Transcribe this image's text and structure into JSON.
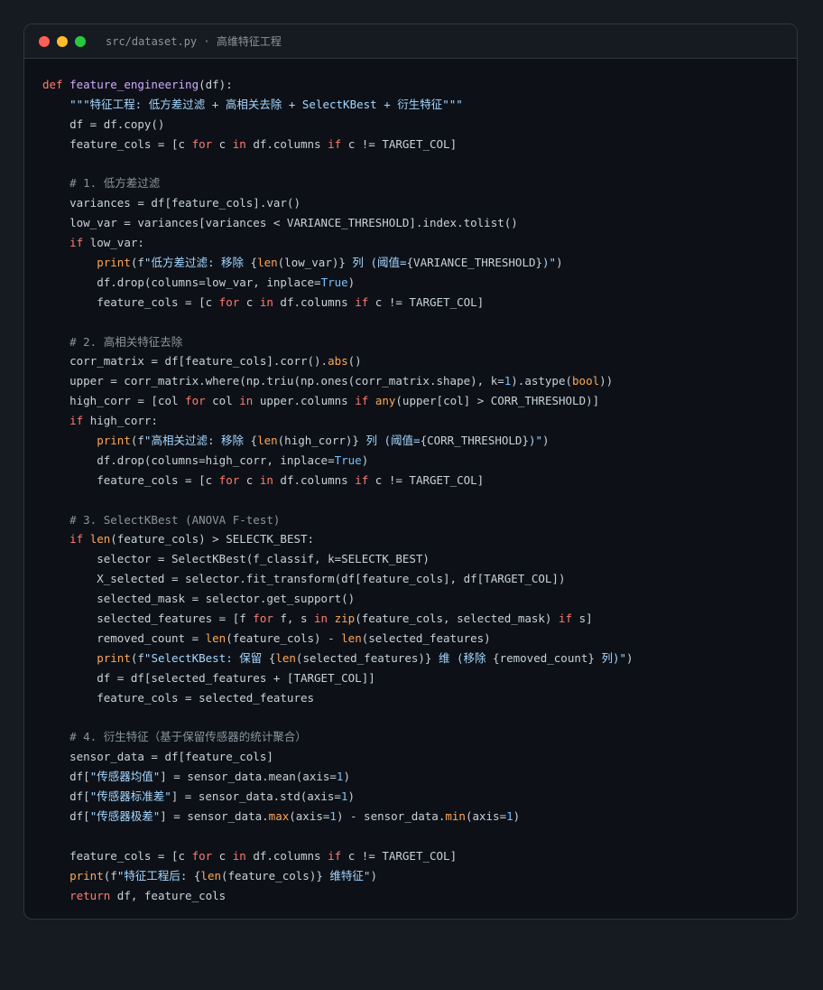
{
  "window": {
    "filename": "src/dataset.py · 高维特征工程",
    "dot_colors": [
      "#ff5f57",
      "#febc2e",
      "#28c840"
    ]
  },
  "code_lines": [
    [
      [
        "kw",
        "def "
      ],
      [
        "fn",
        "feature_engineering"
      ],
      [
        "pl",
        "(df):"
      ]
    ],
    [
      [
        "pl",
        "    "
      ],
      [
        "str",
        "\"\"\"特征工程: 低方差过滤 + 高相关去除 + SelectKBest + 衍生特征\"\"\""
      ]
    ],
    [
      [
        "pl",
        "    df = df.copy()"
      ]
    ],
    [
      [
        "pl",
        "    feature_cols = [c "
      ],
      [
        "kw",
        "for"
      ],
      [
        "pl",
        " c "
      ],
      [
        "kw",
        "in"
      ],
      [
        "pl",
        " df.columns "
      ],
      [
        "kw",
        "if"
      ],
      [
        "pl",
        " c != TARGET_COL]"
      ]
    ],
    [],
    [
      [
        "pl",
        "    "
      ],
      [
        "cm",
        "# 1. 低方差过滤"
      ]
    ],
    [
      [
        "pl",
        "    variances = df[feature_cols].var()"
      ]
    ],
    [
      [
        "pl",
        "    low_var = variances[variances < VARIANCE_THRESHOLD].index.tolist()"
      ]
    ],
    [
      [
        "pl",
        "    "
      ],
      [
        "kw",
        "if"
      ],
      [
        "pl",
        " low_var:"
      ]
    ],
    [
      [
        "pl",
        "        "
      ],
      [
        "bi",
        "print"
      ],
      [
        "pl",
        "(f"
      ],
      [
        "str",
        "\"低方差过滤: 移除 "
      ],
      [
        "pl",
        "{"
      ],
      [
        "bi",
        "len"
      ],
      [
        "pl",
        "(low_var)}"
      ],
      [
        "str",
        " 列 (阈值="
      ],
      [
        "pl",
        "{VARIANCE_THRESHOLD}"
      ],
      [
        "str",
        ")\""
      ],
      [
        "pl",
        ")"
      ]
    ],
    [
      [
        "pl",
        "        df.drop(columns=low_var, inplace="
      ],
      [
        "num",
        "True"
      ],
      [
        "pl",
        ")"
      ]
    ],
    [
      [
        "pl",
        "        feature_cols = [c "
      ],
      [
        "kw",
        "for"
      ],
      [
        "pl",
        " c "
      ],
      [
        "kw",
        "in"
      ],
      [
        "pl",
        " df.columns "
      ],
      [
        "kw",
        "if"
      ],
      [
        "pl",
        " c != TARGET_COL]"
      ]
    ],
    [],
    [
      [
        "pl",
        "    "
      ],
      [
        "cm",
        "# 2. 高相关特征去除"
      ]
    ],
    [
      [
        "pl",
        "    corr_matrix = df[feature_cols].corr()."
      ],
      [
        "bi",
        "abs"
      ],
      [
        "pl",
        "()"
      ]
    ],
    [
      [
        "pl",
        "    upper = corr_matrix.where(np.triu(np.ones(corr_matrix.shape), k="
      ],
      [
        "num",
        "1"
      ],
      [
        "pl",
        ").astype("
      ],
      [
        "bi",
        "bool"
      ],
      [
        "pl",
        "))"
      ]
    ],
    [
      [
        "pl",
        "    high_corr = [col "
      ],
      [
        "kw",
        "for"
      ],
      [
        "pl",
        " col "
      ],
      [
        "kw",
        "in"
      ],
      [
        "pl",
        " upper.columns "
      ],
      [
        "kw",
        "if"
      ],
      [
        "pl",
        " "
      ],
      [
        "bi",
        "any"
      ],
      [
        "pl",
        "(upper[col] > CORR_THRESHOLD)]"
      ]
    ],
    [
      [
        "pl",
        "    "
      ],
      [
        "kw",
        "if"
      ],
      [
        "pl",
        " high_corr:"
      ]
    ],
    [
      [
        "pl",
        "        "
      ],
      [
        "bi",
        "print"
      ],
      [
        "pl",
        "(f"
      ],
      [
        "str",
        "\"高相关过滤: 移除 "
      ],
      [
        "pl",
        "{"
      ],
      [
        "bi",
        "len"
      ],
      [
        "pl",
        "(high_corr)}"
      ],
      [
        "str",
        " 列 (阈值="
      ],
      [
        "pl",
        "{CORR_THRESHOLD}"
      ],
      [
        "str",
        ")\""
      ],
      [
        "pl",
        ")"
      ]
    ],
    [
      [
        "pl",
        "        df.drop(columns=high_corr, inplace="
      ],
      [
        "num",
        "True"
      ],
      [
        "pl",
        ")"
      ]
    ],
    [
      [
        "pl",
        "        feature_cols = [c "
      ],
      [
        "kw",
        "for"
      ],
      [
        "pl",
        " c "
      ],
      [
        "kw",
        "in"
      ],
      [
        "pl",
        " df.columns "
      ],
      [
        "kw",
        "if"
      ],
      [
        "pl",
        " c != TARGET_COL]"
      ]
    ],
    [],
    [
      [
        "pl",
        "    "
      ],
      [
        "cm",
        "# 3. SelectKBest (ANOVA F-test)"
      ]
    ],
    [
      [
        "pl",
        "    "
      ],
      [
        "kw",
        "if"
      ],
      [
        "pl",
        " "
      ],
      [
        "bi",
        "len"
      ],
      [
        "pl",
        "(feature_cols) > SELECTK_BEST:"
      ]
    ],
    [
      [
        "pl",
        "        selector = SelectKBest(f_classif, k=SELECTK_BEST)"
      ]
    ],
    [
      [
        "pl",
        "        X_selected = selector.fit_transform(df[feature_cols], df[TARGET_COL])"
      ]
    ],
    [
      [
        "pl",
        "        selected_mask = selector.get_support()"
      ]
    ],
    [
      [
        "pl",
        "        selected_features = [f "
      ],
      [
        "kw",
        "for"
      ],
      [
        "pl",
        " f, s "
      ],
      [
        "kw",
        "in"
      ],
      [
        "pl",
        " "
      ],
      [
        "bi",
        "zip"
      ],
      [
        "pl",
        "(feature_cols, selected_mask) "
      ],
      [
        "kw",
        "if"
      ],
      [
        "pl",
        " s]"
      ]
    ],
    [
      [
        "pl",
        "        removed_count = "
      ],
      [
        "bi",
        "len"
      ],
      [
        "pl",
        "(feature_cols) - "
      ],
      [
        "bi",
        "len"
      ],
      [
        "pl",
        "(selected_features)"
      ]
    ],
    [
      [
        "pl",
        "        "
      ],
      [
        "bi",
        "print"
      ],
      [
        "pl",
        "(f"
      ],
      [
        "str",
        "\"SelectKBest: 保留 "
      ],
      [
        "pl",
        "{"
      ],
      [
        "bi",
        "len"
      ],
      [
        "pl",
        "(selected_features)}"
      ],
      [
        "str",
        " 维 (移除 "
      ],
      [
        "pl",
        "{removed_count}"
      ],
      [
        "str",
        " 列)\""
      ],
      [
        "pl",
        ")"
      ]
    ],
    [
      [
        "pl",
        "        df = df[selected_features + [TARGET_COL]]"
      ]
    ],
    [
      [
        "pl",
        "        feature_cols = selected_features"
      ]
    ],
    [],
    [
      [
        "pl",
        "    "
      ],
      [
        "cm",
        "# 4. 衍生特征（基于保留传感器的统计聚合）"
      ]
    ],
    [
      [
        "pl",
        "    sensor_data = df[feature_cols]"
      ]
    ],
    [
      [
        "pl",
        "    df["
      ],
      [
        "str",
        "\"传感器均值\""
      ],
      [
        "pl",
        "] = sensor_data.mean(axis="
      ],
      [
        "num",
        "1"
      ],
      [
        "pl",
        ")"
      ]
    ],
    [
      [
        "pl",
        "    df["
      ],
      [
        "str",
        "\"传感器标准差\""
      ],
      [
        "pl",
        "] = sensor_data.std(axis="
      ],
      [
        "num",
        "1"
      ],
      [
        "pl",
        ")"
      ]
    ],
    [
      [
        "pl",
        "    df["
      ],
      [
        "str",
        "\"传感器极差\""
      ],
      [
        "pl",
        "] = sensor_data."
      ],
      [
        "bi",
        "max"
      ],
      [
        "pl",
        "(axis="
      ],
      [
        "num",
        "1"
      ],
      [
        "pl",
        ") - sensor_data."
      ],
      [
        "bi",
        "min"
      ],
      [
        "pl",
        "(axis="
      ],
      [
        "num",
        "1"
      ],
      [
        "pl",
        ")"
      ]
    ],
    [],
    [
      [
        "pl",
        "    feature_cols = [c "
      ],
      [
        "kw",
        "for"
      ],
      [
        "pl",
        " c "
      ],
      [
        "kw",
        "in"
      ],
      [
        "pl",
        " df.columns "
      ],
      [
        "kw",
        "if"
      ],
      [
        "pl",
        " c != TARGET_COL]"
      ]
    ],
    [
      [
        "pl",
        "    "
      ],
      [
        "bi",
        "print"
      ],
      [
        "pl",
        "(f"
      ],
      [
        "str",
        "\"特征工程后: "
      ],
      [
        "pl",
        "{"
      ],
      [
        "bi",
        "len"
      ],
      [
        "pl",
        "(feature_cols)}"
      ],
      [
        "str",
        " 维特征\""
      ],
      [
        "pl",
        ")"
      ]
    ],
    [
      [
        "pl",
        "    "
      ],
      [
        "kw",
        "return"
      ],
      [
        "pl",
        " df, feature_cols"
      ]
    ]
  ]
}
